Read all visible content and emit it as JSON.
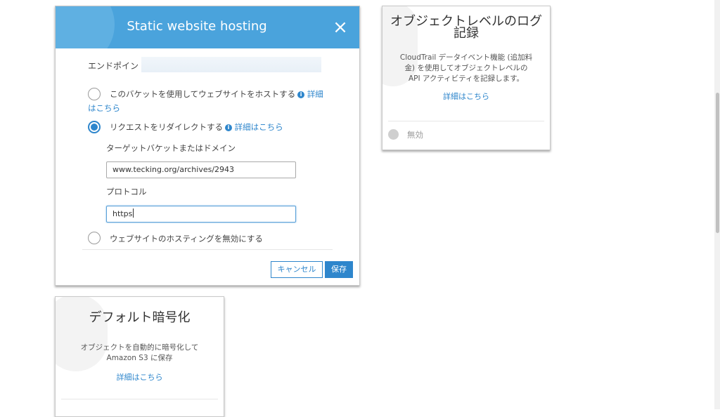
{
  "modal": {
    "title": "Static website hosting",
    "close_glyph": "×",
    "endpoint_label": "エンドポイント:",
    "options": [
      {
        "label": "このバケットを使用してウェブサイトをホストする",
        "link_1": "詳細",
        "link_2": "はこちら",
        "checked": false
      },
      {
        "label": "リクエストをリダイレクトする",
        "link": "詳細はこちら",
        "checked": true
      },
      {
        "label": "ウェブサイトのホスティングを無効にする",
        "checked": false
      }
    ],
    "target_label": "ターゲットバケットまたはドメイン",
    "target_value": "www.tecking.org/archives/2943",
    "protocol_label": "プロトコル",
    "protocol_value": "https",
    "cancel_label": "キャンセル",
    "save_label": "保存",
    "info_glyph": "i",
    "accent_color": "#2e86cc",
    "header_color": "#4aa3dc"
  },
  "log_card": {
    "title_line1": "オブジェクトレベルのログ",
    "title_line2": "記録",
    "desc_line1": "CloudTrail データイベント機能 (追加料",
    "desc_line2": "金) を使用してオブジェクトレベルの",
    "desc_line3": "API アクティビティを記録します。",
    "link": "詳細はこちら",
    "status": "無効"
  },
  "encryption_card": {
    "title": "デフォルト暗号化",
    "desc_line1": "オブジェクトを自動的に暗号化して",
    "desc_line2": "Amazon S3 に保存",
    "link": "詳細はこちら"
  }
}
